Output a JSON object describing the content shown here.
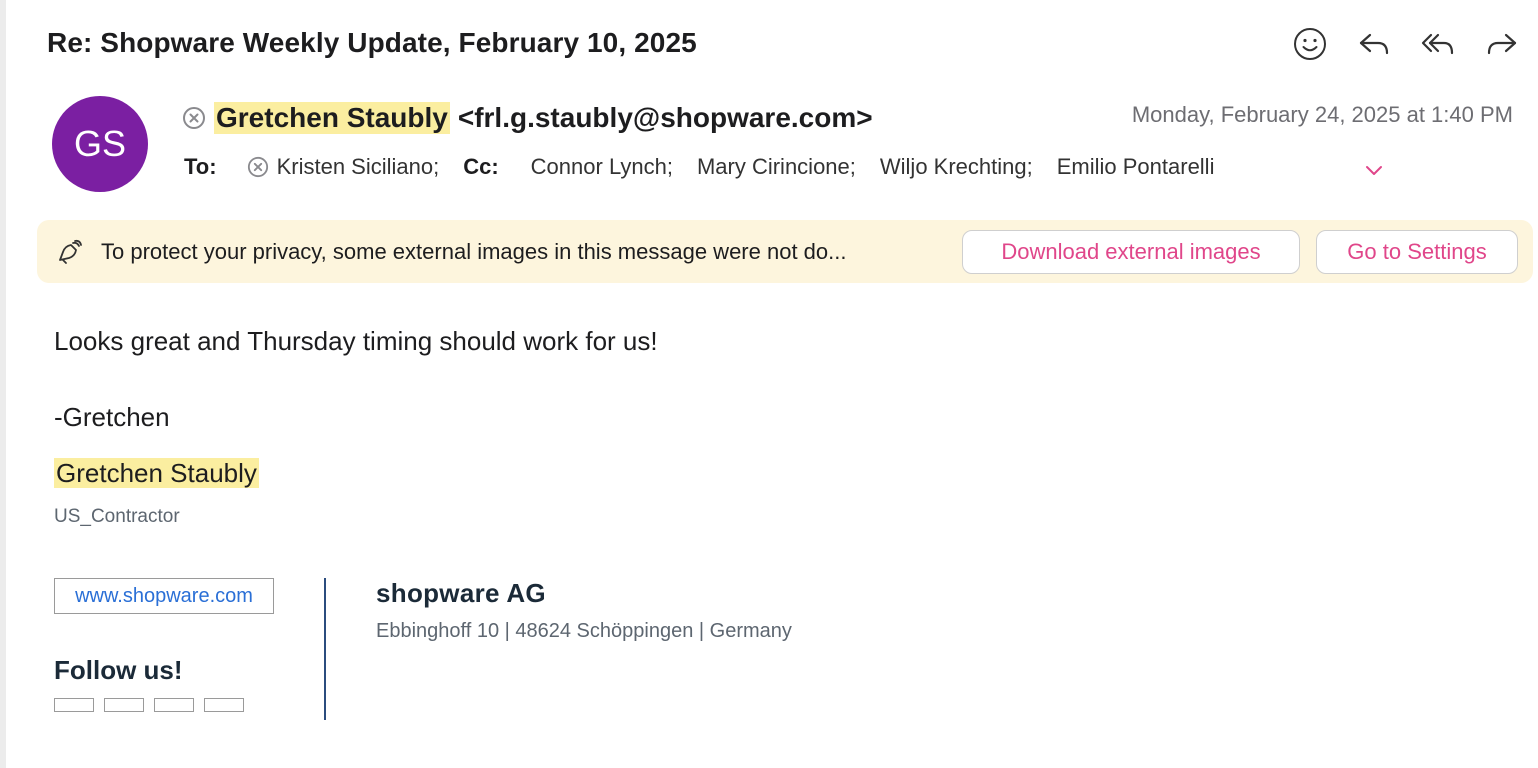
{
  "email": {
    "subject": "Re: Shopware Weekly Update, February 10, 2025",
    "sender": {
      "initials": "GS",
      "name": "Gretchen Staubly",
      "email": "<frl.g.staubly@shopware.com>",
      "avatar_color": "#7b1fa2"
    },
    "date": "Monday, February 24, 2025 at 1:40 PM",
    "to_label": "To:",
    "to": [
      "Kristen Siciliano;"
    ],
    "cc_label": "Cc:",
    "cc": [
      "Connor Lynch;",
      "Mary Cirincione;",
      "Wiljo Krechting;",
      "Emilio Pontarelli"
    ]
  },
  "toolbar": {
    "icons": [
      "smiley-icon",
      "reply-icon",
      "reply-all-icon",
      "forward-icon"
    ]
  },
  "privacy": {
    "text": "To protect your privacy, some external images in this message were not do...",
    "download_label": "Download external images",
    "settings_label": "Go to Settings",
    "accent": "#e0468a",
    "background": "#fdf5dd"
  },
  "body": {
    "line1": "Looks great and Thursday timing should work for us!",
    "signoff": "-Gretchen"
  },
  "signature": {
    "name": "Gretchen Staubly",
    "title": "US_Contractor",
    "website": "www.shopware.com",
    "follow": "Follow us!",
    "company": "shopware AG",
    "address": "Ebbinghoff 10 | 48624 Schöppingen | Germany"
  }
}
